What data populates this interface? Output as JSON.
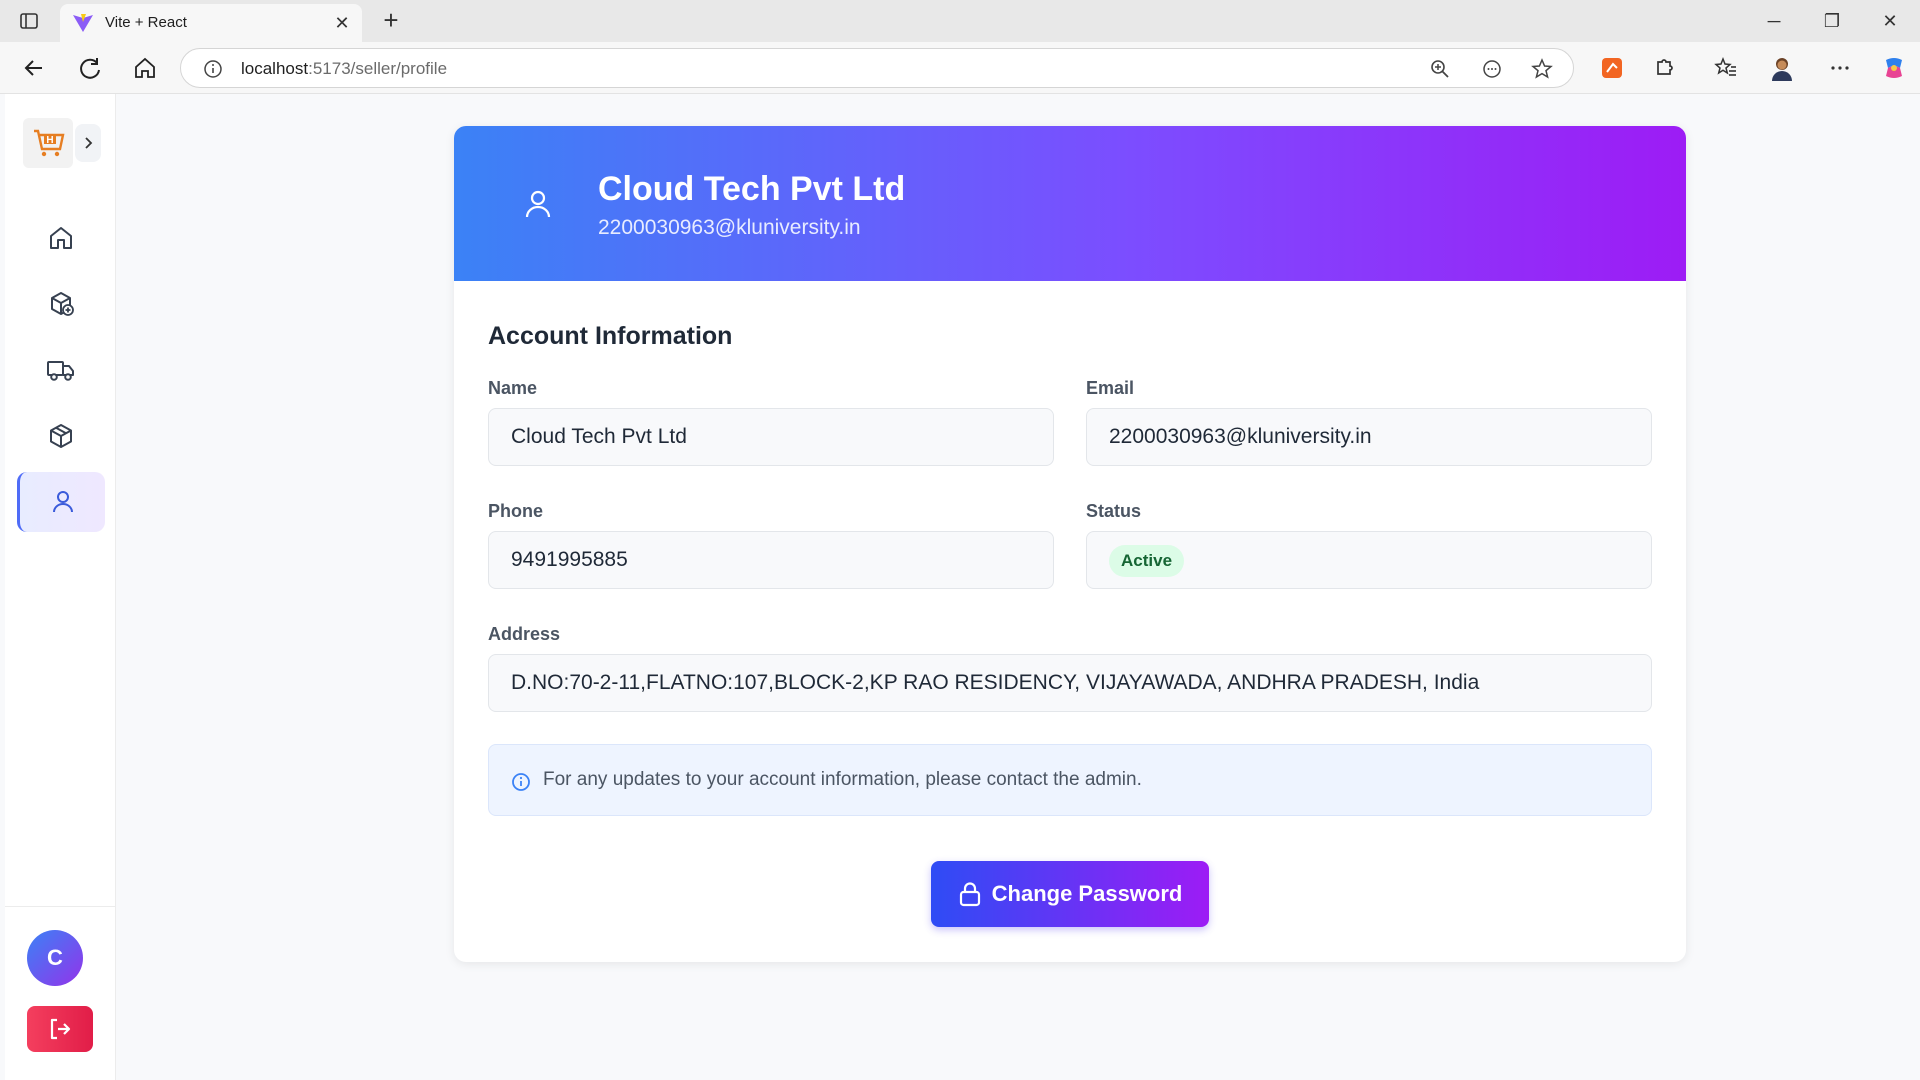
{
  "browser": {
    "tab_title": "Vite + React",
    "url_host": "localhost",
    "url_path": ":5173/seller/profile"
  },
  "sidebar": {
    "items": [
      {
        "name": "dashboard",
        "icon": "home-icon",
        "active": false
      },
      {
        "name": "add-product",
        "icon": "package-plus-icon",
        "active": false
      },
      {
        "name": "orders",
        "icon": "truck-icon",
        "active": false
      },
      {
        "name": "products",
        "icon": "package-icon",
        "active": false
      },
      {
        "name": "profile",
        "icon": "user-icon",
        "active": true
      }
    ],
    "avatar_initial": "C"
  },
  "profile": {
    "name": "Cloud Tech Pvt Ltd",
    "email": "2200030963@kluniversity.in"
  },
  "account": {
    "section_title": "Account Information",
    "name_label": "Name",
    "name_value": "Cloud Tech Pvt Ltd",
    "email_label": "Email",
    "email_value": "2200030963@kluniversity.in",
    "phone_label": "Phone",
    "phone_value": "9491995885",
    "status_label": "Status",
    "status_value": "Active",
    "address_label": "Address",
    "address_value": "D.NO:70-2-11,FLATNO:107,BLOCK-2,KP RAO RESIDENCY, VIJAYAWADA, ANDHRA PRADESH, India"
  },
  "notice": {
    "text": "For any updates to your account information, please contact the admin."
  },
  "actions": {
    "change_password_label": "Change Password"
  },
  "colors": {
    "header_gradient_start": "#3b82f6",
    "header_gradient_end": "#9d1cf5",
    "status_active_bg": "#dcfce7",
    "status_active_text": "#166534",
    "logout_bg": "#f43f5e"
  }
}
